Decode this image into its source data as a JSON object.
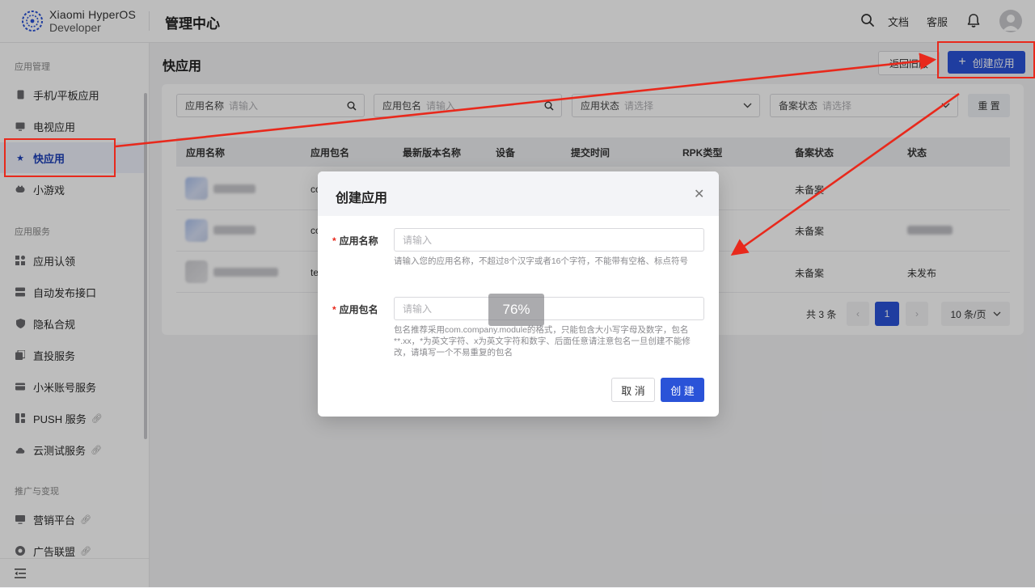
{
  "brand": {
    "line1": "Xiaomi HyperOS",
    "line2": "Developer"
  },
  "header": {
    "title": "管理中心",
    "docs": "文档",
    "support": "客服"
  },
  "sidebar": {
    "sections": [
      {
        "title": "应用管理"
      },
      {
        "title": "应用服务"
      },
      {
        "title": "推广与变现"
      }
    ],
    "items": [
      {
        "label": "手机/平板应用",
        "icon": "phone-icon"
      },
      {
        "label": "电视应用",
        "icon": "tv-icon"
      },
      {
        "label": "快应用",
        "icon": "star-icon",
        "active": true
      },
      {
        "label": "小游戏",
        "icon": "gamepad-icon"
      },
      {
        "label": "应用认领",
        "icon": "grid-icon"
      },
      {
        "label": "自动发布接口",
        "icon": "server-icon"
      },
      {
        "label": "隐私合规",
        "icon": "shield-icon"
      },
      {
        "label": "直投服务",
        "icon": "copy-icon"
      },
      {
        "label": "小米账号服务",
        "icon": "card-icon"
      },
      {
        "label": "PUSH 服务",
        "icon": "push-icon",
        "link": true
      },
      {
        "label": "云测试服务",
        "icon": "cloud-icon",
        "link": true
      },
      {
        "label": "营销平台",
        "icon": "monitor-icon",
        "link": true
      },
      {
        "label": "广告联盟",
        "icon": "ad-icon",
        "link": true
      }
    ]
  },
  "page": {
    "title": "快应用",
    "back_button": "返回旧版",
    "create_button": "创建应用",
    "filters": [
      {
        "label": "应用名称",
        "placeholder": "请输入"
      },
      {
        "label": "应用包名",
        "placeholder": "请输入"
      },
      {
        "label": "应用状态",
        "placeholder": "请选择"
      },
      {
        "label": "备案状态",
        "placeholder": "请选择"
      }
    ],
    "reset_button": "重 置",
    "table": {
      "columns": [
        "应用名称",
        "应用包名",
        "最新版本名称",
        "设备",
        "提交时间",
        "RPK类型",
        "备案状态",
        "状态"
      ],
      "rows": [
        {
          "package": "co",
          "filing": "未备案",
          "status": ""
        },
        {
          "package": "co",
          "filing": "未备案",
          "status": ""
        },
        {
          "package": "te",
          "filing": "未备案",
          "status": "未发布"
        }
      ]
    },
    "pagination": {
      "total": "共 3 条",
      "current": "1",
      "page_size": "10 条/页"
    }
  },
  "modal": {
    "title": "创建应用",
    "name_label": "应用名称",
    "name_placeholder": "请输入",
    "name_hint": "请输入您的应用名称，不超过8个汉字或者16个字符，不能带有空格、标点符号",
    "package_label": "应用包名",
    "package_placeholder": "请输入",
    "package_hint": "包名推荐采用com.company.module的格式，只能包含大小写字母及数字，包名**.xx，*为英文字符、x为英文字符和数字、后面任意请注意包名一旦创建不能修改，请填写一个不易重复的包名",
    "cancel_button": "取 消",
    "ok_button": "创 建",
    "zoom": "76%"
  },
  "colors": {
    "primary": "#2a53d8",
    "annotation": "#e8291c"
  }
}
